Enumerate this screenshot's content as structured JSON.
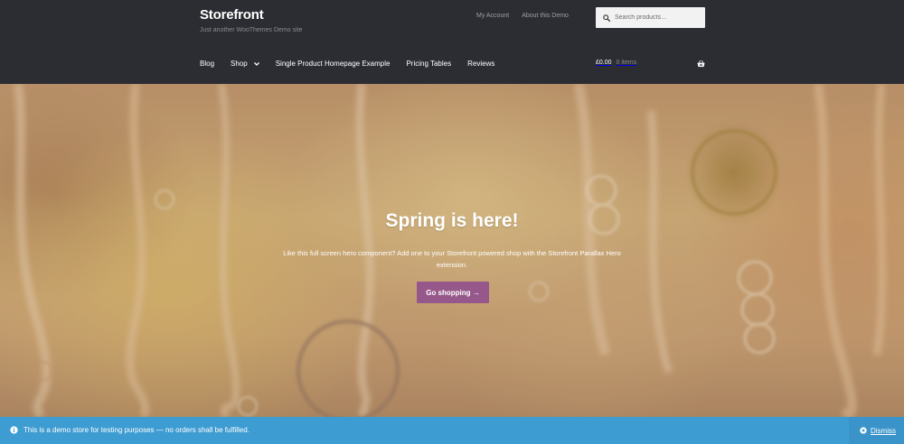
{
  "site": {
    "title": "Storefront",
    "description": "Just another WooThemes Demo site"
  },
  "secondary_nav": [
    {
      "label": "My Account"
    },
    {
      "label": "About this Demo"
    }
  ],
  "search": {
    "placeholder": "Search products…"
  },
  "main_nav": [
    {
      "label": "Blog"
    },
    {
      "label": "Shop"
    },
    {
      "label": "Single Product Homepage Example"
    },
    {
      "label": "Pricing Tables"
    },
    {
      "label": "Reviews"
    }
  ],
  "cart": {
    "amount": "£0.00",
    "count": "0 items"
  },
  "hero": {
    "title": "Spring is here!",
    "text": "Like this full screen hero component? Add one to your Storefront powered shop with the Storefront Parallax Hero extension.",
    "button": "Go shopping →"
  },
  "notice": {
    "message": "This is a demo store for testing purposes — no orders shall be fulfilled.",
    "dismiss": "Dismiss"
  },
  "colors": {
    "header_bg": "#2c2d33",
    "button": "#96588a",
    "notice_bg": "#3d9cd2"
  }
}
